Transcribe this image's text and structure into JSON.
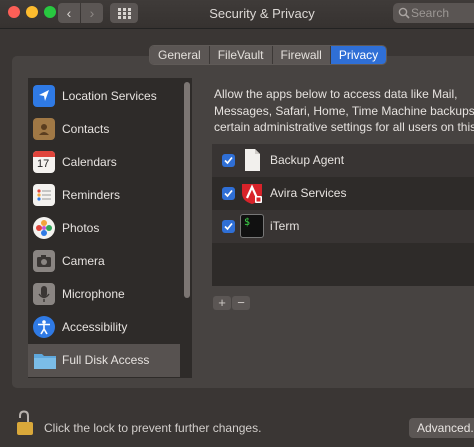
{
  "window": {
    "title": "Security & Privacy"
  },
  "search": {
    "placeholder": "Search"
  },
  "tabs": [
    {
      "label": "General",
      "active": false
    },
    {
      "label": "FileVault",
      "active": false
    },
    {
      "label": "Firewall",
      "active": false
    },
    {
      "label": "Privacy",
      "active": true
    }
  ],
  "sidebar": {
    "items": [
      {
        "label": "Location Services",
        "icon": "location-arrow-icon"
      },
      {
        "label": "Contacts",
        "icon": "contacts-book-icon"
      },
      {
        "label": "Calendars",
        "icon": "calendar-icon",
        "icon_text": "17"
      },
      {
        "label": "Reminders",
        "icon": "reminders-list-icon"
      },
      {
        "label": "Photos",
        "icon": "photos-flower-icon"
      },
      {
        "label": "Camera",
        "icon": "camera-icon"
      },
      {
        "label": "Microphone",
        "icon": "microphone-icon"
      },
      {
        "label": "Accessibility",
        "icon": "accessibility-icon"
      },
      {
        "label": "Full Disk Access",
        "icon": "folder-icon",
        "selected": true
      }
    ]
  },
  "description": {
    "lines": [
      "Allow the apps below to access data like Mail,",
      "Messages, Safari, Home, Time Machine backups and",
      "certain administrative settings for all users on this Ma"
    ]
  },
  "apps": [
    {
      "name": "Backup Agent",
      "checked": true,
      "icon": "document-icon"
    },
    {
      "name": "Avira Services",
      "checked": true,
      "icon": "avira-umbrella-icon"
    },
    {
      "name": "iTerm",
      "checked": true,
      "icon": "terminal-icon",
      "icon_text": "$"
    }
  ],
  "controls": {
    "add_label": "+",
    "remove_label": "−"
  },
  "footer": {
    "lock_text": "Click the lock to prevent further changes.",
    "advanced_label": "Advanced..."
  },
  "colors": {
    "accent": "#2f6fd6",
    "background": "#3a3634",
    "list_bg": "#2e2b29"
  }
}
